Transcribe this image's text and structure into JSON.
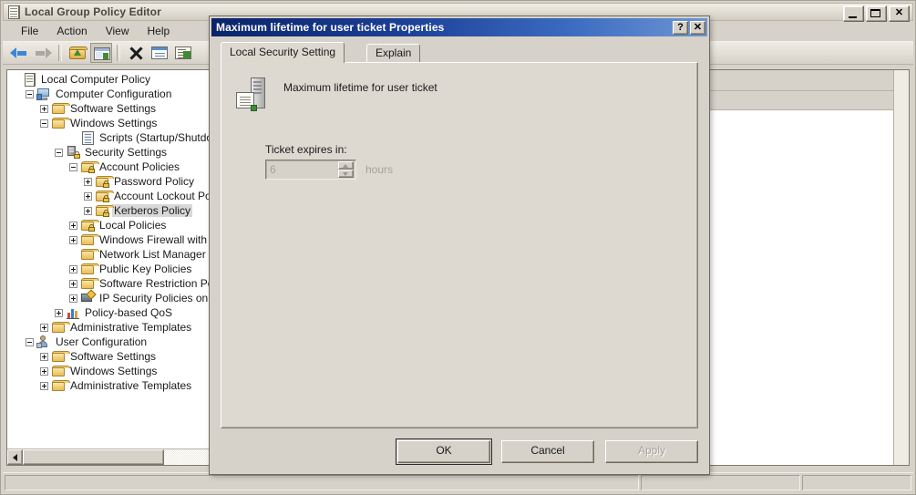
{
  "window": {
    "title": "Local Group Policy Editor",
    "icon": "policy-document-icon",
    "controls": {
      "minimize": "_",
      "maximize": "☐",
      "close": "✕"
    }
  },
  "menu": {
    "items": [
      "File",
      "Action",
      "View",
      "Help"
    ]
  },
  "toolbar": {
    "items": [
      {
        "name": "back-button",
        "icon": "back-arrow-icon"
      },
      {
        "name": "forward-button",
        "icon": "forward-arrow-icon"
      },
      {
        "name": "up-one-level-button",
        "icon": "folder-up-icon"
      },
      {
        "name": "show-hide-console-tree-button",
        "icon": "console-tree-icon"
      },
      {
        "name": "delete-button",
        "icon": "delete-x-icon"
      },
      {
        "name": "properties-button",
        "icon": "properties-icon"
      },
      {
        "name": "help-button",
        "icon": "help-list-icon"
      }
    ]
  },
  "tree": {
    "nodes": [
      {
        "label": "Local Computer Policy",
        "indent": 0,
        "expander": "none",
        "icon": "policy-document-icon",
        "selected": false
      },
      {
        "label": "Computer Configuration",
        "indent": 1,
        "expander": "minus",
        "icon": "computer-icon",
        "selected": false
      },
      {
        "label": "Software Settings",
        "indent": 2,
        "expander": "plus",
        "icon": "folder-icon",
        "selected": false
      },
      {
        "label": "Windows Settings",
        "indent": 2,
        "expander": "minus",
        "icon": "folder-icon",
        "selected": false
      },
      {
        "label": "Scripts (Startup/Shutdown)",
        "indent": 4,
        "expander": "none",
        "icon": "script-icon",
        "selected": false
      },
      {
        "label": "Security Settings",
        "indent": 3,
        "expander": "minus",
        "icon": "security-server-icon",
        "selected": false
      },
      {
        "label": "Account Policies",
        "indent": 4,
        "expander": "minus",
        "icon": "folder-lock-icon",
        "selected": false
      },
      {
        "label": "Password Policy",
        "indent": 5,
        "expander": "plus",
        "icon": "folder-lock-icon",
        "selected": false
      },
      {
        "label": "Account Lockout Policy",
        "indent": 5,
        "expander": "plus",
        "icon": "folder-lock-icon",
        "selected": false
      },
      {
        "label": "Kerberos Policy",
        "indent": 5,
        "expander": "plus",
        "icon": "folder-lock-icon",
        "selected": true
      },
      {
        "label": "Local Policies",
        "indent": 4,
        "expander": "plus",
        "icon": "folder-lock-icon",
        "selected": false
      },
      {
        "label": "Windows Firewall with Advanced Security",
        "indent": 4,
        "expander": "plus",
        "icon": "folder-icon",
        "selected": false
      },
      {
        "label": "Network List Manager Policies",
        "indent": 4,
        "expander": "none",
        "icon": "folder-icon",
        "selected": false
      },
      {
        "label": "Public Key Policies",
        "indent": 4,
        "expander": "plus",
        "icon": "folder-icon",
        "selected": false
      },
      {
        "label": "Software Restriction Policies",
        "indent": 4,
        "expander": "plus",
        "icon": "folder-icon",
        "selected": false
      },
      {
        "label": "IP Security Policies on Local Computer",
        "indent": 4,
        "expander": "plus",
        "icon": "ip-security-icon",
        "selected": false
      },
      {
        "label": "Policy-based QoS",
        "indent": 3,
        "expander": "plus",
        "icon": "qos-chart-icon",
        "selected": false
      },
      {
        "label": "Administrative Templates",
        "indent": 2,
        "expander": "plus",
        "icon": "folder-icon",
        "selected": false
      },
      {
        "label": "User Configuration",
        "indent": 1,
        "expander": "minus",
        "icon": "user-icon",
        "selected": false
      },
      {
        "label": "Software Settings",
        "indent": 2,
        "expander": "plus",
        "icon": "folder-icon",
        "selected": false
      },
      {
        "label": "Windows Settings",
        "indent": 2,
        "expander": "plus",
        "icon": "folder-icon",
        "selected": false
      },
      {
        "label": "Administrative Templates",
        "indent": 2,
        "expander": "plus",
        "icon": "folder-icon",
        "selected": false
      }
    ]
  },
  "statusbar": {
    "pane1": "",
    "pane2": "",
    "pane3": ""
  },
  "dialog": {
    "title": "Maximum lifetime for user ticket Properties",
    "help_button": "?",
    "close_button": "✕",
    "tabs": [
      {
        "label": "Local Security Setting",
        "active": true
      },
      {
        "label": "Explain",
        "active": false
      }
    ],
    "policy_name": "Maximum lifetime for user ticket",
    "policy_icon": "policy-setting-icon",
    "field": {
      "label": "Ticket expires in:",
      "value": "6",
      "units": "hours",
      "disabled": true
    },
    "buttons": [
      {
        "label": "OK",
        "state": "default"
      },
      {
        "label": "Cancel",
        "state": "normal"
      },
      {
        "label": "Apply",
        "state": "disabled"
      }
    ]
  },
  "colors": {
    "face": "#d6d2ca",
    "dialog_title_start": "#0a246a",
    "dialog_title_end": "#6f96d4",
    "selection": "#d8d8d8",
    "disabled_text": "#a6a29a"
  }
}
